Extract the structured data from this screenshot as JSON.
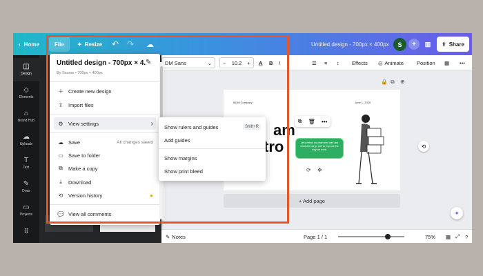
{
  "topbar": {
    "home": "Home",
    "file": "File",
    "resize": "Resize",
    "doc_title": "Untitled design - 700px × 400px",
    "avatar_initial": "S",
    "share": "Share"
  },
  "sidenav": {
    "items": [
      {
        "label": "Design",
        "icon": "layout-icon"
      },
      {
        "label": "Elements",
        "icon": "shapes-icon"
      },
      {
        "label": "Brand Hub",
        "icon": "brand-icon"
      },
      {
        "label": "Uploads",
        "icon": "upload-icon"
      },
      {
        "label": "Text",
        "icon": "text-icon"
      },
      {
        "label": "Draw",
        "icon": "pen-icon"
      },
      {
        "label": "Projects",
        "icon": "folder-icon"
      }
    ]
  },
  "toolbar": {
    "font": "DM Sans",
    "size": "10.2",
    "effects": "Effects",
    "animate": "Animate",
    "position": "Position"
  },
  "file_menu": {
    "title": "Untitled design - 700px × 4...",
    "subtitle": "By Saurav • 700px × 400px",
    "items": [
      {
        "label": "Create new design",
        "icon": "plus-icon"
      },
      {
        "label": "Import files",
        "icon": "upload-icon"
      },
      {
        "label": "View settings",
        "icon": "gear-icon"
      },
      {
        "label": "Save",
        "icon": "cloud-icon",
        "status": "All changes saved"
      },
      {
        "label": "Save to folder",
        "icon": "folder-icon"
      },
      {
        "label": "Make a copy",
        "icon": "copy-icon"
      },
      {
        "label": "Download",
        "icon": "download-icon"
      },
      {
        "label": "Version history",
        "icon": "history-icon"
      },
      {
        "label": "View all comments",
        "icon": "comment-icon"
      }
    ]
  },
  "view_submenu": {
    "items": [
      {
        "label": "Show rulers and guides",
        "shortcut": "Shift+R"
      },
      {
        "label": "Add guides"
      },
      {
        "label": "Show margins"
      },
      {
        "label": "Show print bleed"
      }
    ]
  },
  "page": {
    "company": "MDM Company",
    "date": "June 1, 2020",
    "big_text_1": "am",
    "big_text_2": "tro",
    "bubble_text": "Let's reflect on what went well and what did not go well to improve the way we work."
  },
  "canvas": {
    "add_page": "+ Add page"
  },
  "footer": {
    "notes": "Notes",
    "page": "Page 1 / 1",
    "zoom": "75%",
    "zoom_level": 0.75
  },
  "colors": {
    "highlight": "#e4562d",
    "bubble": "#2eae63",
    "avatar": "#1b5c2e"
  }
}
